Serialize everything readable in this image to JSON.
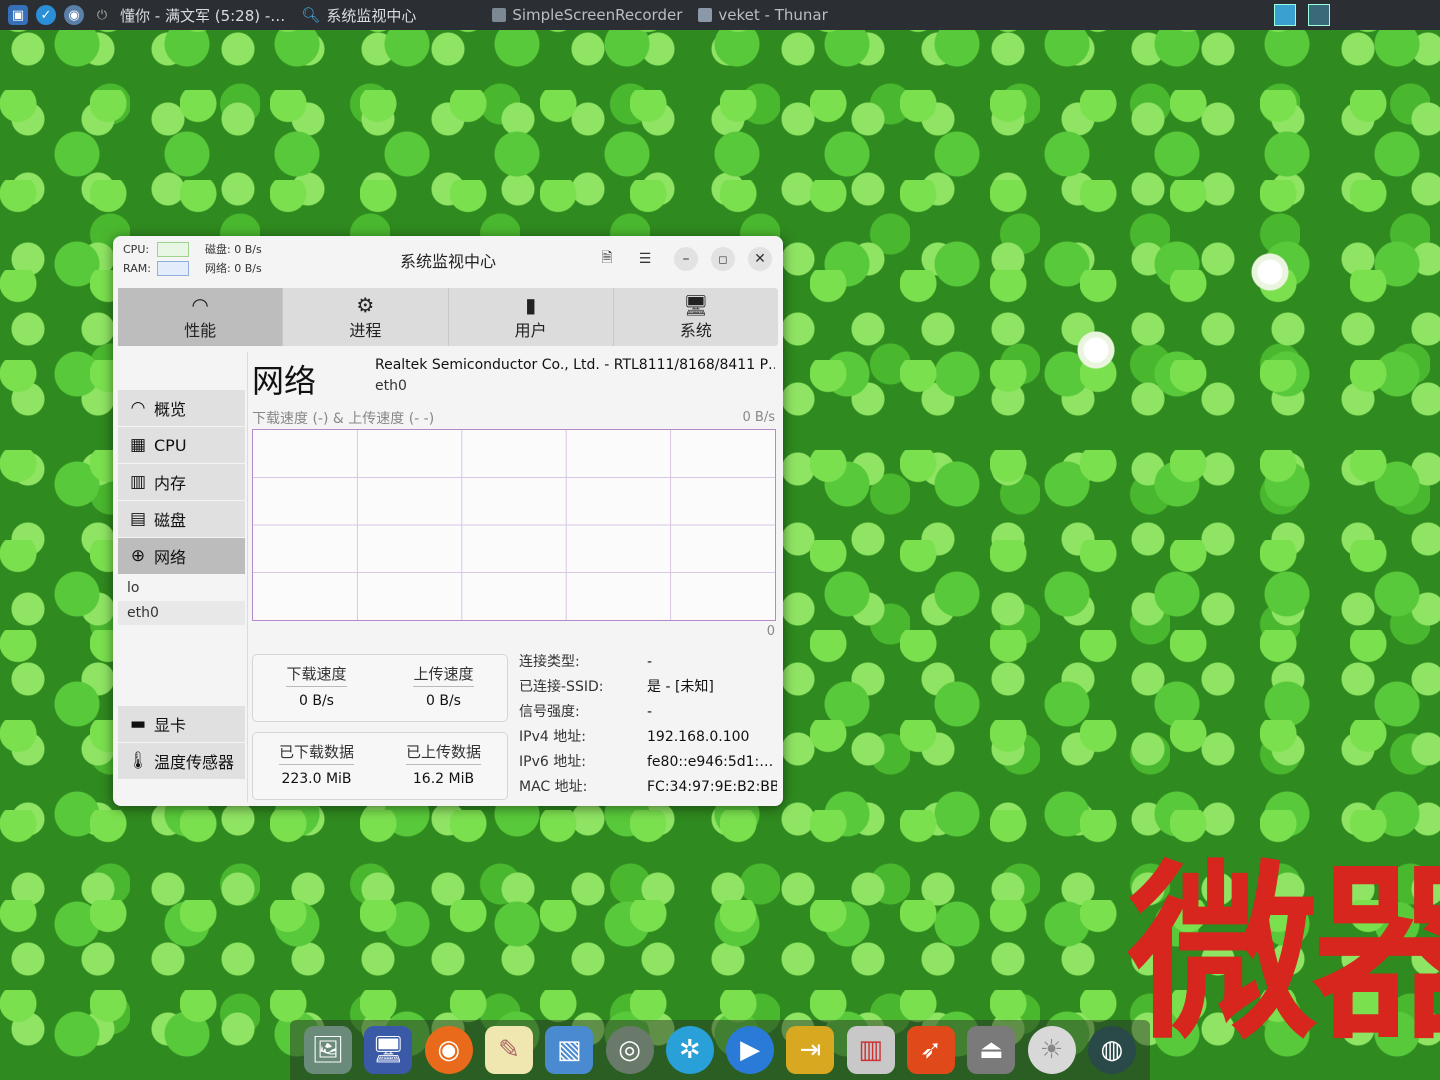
{
  "taskbar": {
    "tasks": [
      {
        "icon": "music-icon",
        "label": "懂你 - 满文军 (5:28) -…"
      },
      {
        "icon": "search-icon",
        "label": "系统监视中心"
      },
      {
        "icon": "window-icon",
        "label": "SimpleScreenRecorder"
      },
      {
        "icon": "folder-icon",
        "label": "veket - Thunar"
      }
    ]
  },
  "window": {
    "title": "系统监视中心",
    "mini": {
      "cpu_label": "CPU:",
      "ram_label": "RAM:",
      "disk_label": "磁盘:",
      "disk_value": "0 B/s",
      "net_label": "网络:",
      "net_value": "0 B/s"
    },
    "tabs": [
      {
        "label": "性能",
        "icon": "gauge-icon"
      },
      {
        "label": "进程",
        "icon": "gear-icon"
      },
      {
        "label": "用户",
        "icon": "mouse-icon"
      },
      {
        "label": "系统",
        "icon": "monitor-icon"
      }
    ],
    "sidebar": {
      "items": [
        {
          "label": "概览",
          "icon": "gauge-icon"
        },
        {
          "label": "CPU",
          "icon": "cpu-icon"
        },
        {
          "label": "内存",
          "icon": "memory-icon"
        },
        {
          "label": "磁盘",
          "icon": "disk-icon"
        },
        {
          "label": "网络",
          "icon": "globe-icon"
        }
      ],
      "subitems": [
        "lo",
        "eth0"
      ],
      "bottom_items": [
        {
          "label": "显卡",
          "icon": "gpu-icon"
        },
        {
          "label": "温度传感器",
          "icon": "thermometer-icon"
        }
      ]
    },
    "main": {
      "heading": "网络",
      "device": "Realtek Semiconductor Co., Ltd. - RTL8111/8168/8411 P…",
      "interface": "eth0",
      "graph_label": "下载速度 (-) & 上传速度 (-  -)",
      "graph_max": "0 B/s",
      "graph_zero": "0",
      "speed": {
        "down_label": "下载速度",
        "down_value": "0 B/s",
        "up_label": "上传速度",
        "up_value": "0 B/s"
      },
      "data": {
        "down_label": "已下载数据",
        "down_value": "223.0 MiB",
        "up_label": "已上传数据",
        "up_value": "16.2 MiB"
      },
      "info": [
        {
          "key": "连接类型:",
          "value": "-"
        },
        {
          "key": "已连接-SSID:",
          "value": "是 - [未知]"
        },
        {
          "key": "信号强度:",
          "value": "-"
        },
        {
          "key": "IPv4 地址:",
          "value": "192.168.0.100"
        },
        {
          "key": "IPv6 地址:",
          "value": "fe80::e946:5d1:…"
        },
        {
          "key": "MAC 地址:",
          "value": "FC:34:97:9E:B2:BB"
        }
      ]
    }
  },
  "desktop": {
    "overlay_text": "微器"
  },
  "colors": {
    "graph_border": "#b58ac8",
    "overlay": "#d7261e"
  }
}
